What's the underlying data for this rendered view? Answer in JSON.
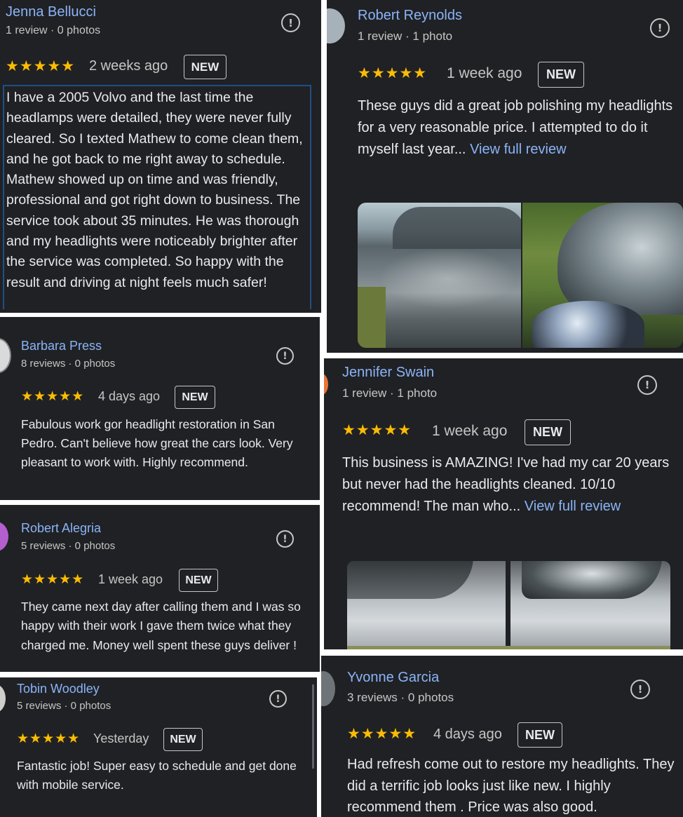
{
  "badge_label": "NEW",
  "reviews": [
    {
      "name": "Jenna Bellucci",
      "meta": "1 review · 0 photos",
      "stars": "★★★★★",
      "time": "2 weeks ago",
      "text": "I have a 2005 Volvo and the last time the headlamps were detailed, they were never fully cleared. So I texted Mathew to come clean them, and he got back to me right away to schedule. Mathew showed up on time and was friendly, professional and got right down to business. The service took about 35 minutes. He was thorough and my headlights were noticeably brighter after the service was completed. So happy with the result and driving at night feels much safer!"
    },
    {
      "name": "Robert Reynolds",
      "meta": "1 review · 1 photo",
      "stars": "★★★★★",
      "time": "1 week ago",
      "text": "These guys did a great job polishing my headlights for a very reasonable price. I attempted to do it myself last year...",
      "more": "View full review"
    },
    {
      "name": "Barbara Press",
      "meta": "8 reviews · 0 photos",
      "stars": "★★★★★",
      "time": "4 days ago",
      "text": "Fabulous work gor headlight restoration in San Pedro. Can't believe how great the cars look. Very pleasant to work with. Highly recommend."
    },
    {
      "name": "Jennifer Swain",
      "meta": "1 review · 1 photo",
      "stars": "★★★★★",
      "time": "1 week ago",
      "text": "This business is AMAZING! I've had my car 20 years but never had the headlights cleaned. 10/10 recommend! The man who...",
      "more": "View full review"
    },
    {
      "name": "Robert Alegria",
      "meta": "5 reviews · 0 photos",
      "stars": "★★★★★",
      "time": "1 week ago",
      "text": "They came next day after calling them and I was so happy with their work I gave them twice what they charged me. Money well spent these guys deliver !"
    },
    {
      "name": "Tobin Woodley",
      "meta": "5 reviews · 0 photos",
      "stars": "★★★★★",
      "time": "Yesterday",
      "text": "Fantastic job! Super easy to schedule and get done with mobile service."
    },
    {
      "name": "Yvonne Garcia",
      "meta": "3 reviews · 0 photos",
      "stars": "★★★★★",
      "time": "4 days ago",
      "text": "Had refresh come out to restore my headlights. They did a terrific job looks just like new. I highly recommend them . Price was also good."
    }
  ],
  "colors": {
    "card_bg": "#202124",
    "name": "#8ab4f8",
    "star": "#fbbc04",
    "text": "#e8eaed",
    "secondary": "#c4c7c5",
    "link": "#8ab4f8"
  },
  "icons": {
    "flag": "report-flag-icon",
    "star": "star-rating-icon"
  }
}
